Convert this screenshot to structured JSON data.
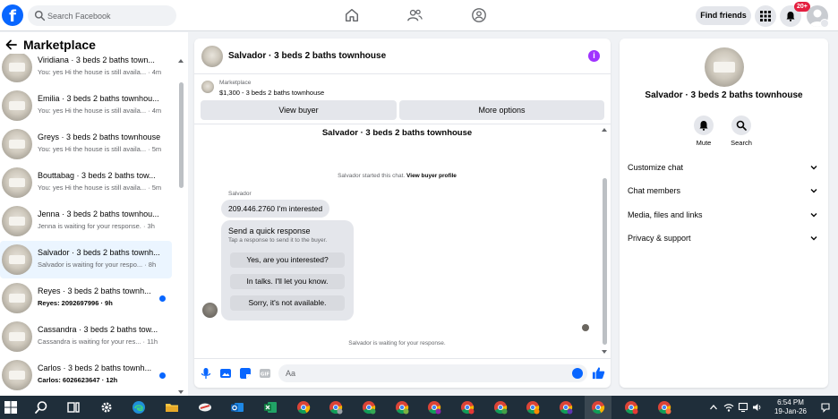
{
  "topbar": {
    "search_placeholder": "Search Facebook",
    "find_friends": "Find friends",
    "notification_count": "20+"
  },
  "left": {
    "title": "Marketplace",
    "conversations": [
      {
        "title": "Viridiana · 3 beds 2 baths town...",
        "sub": "You: yes Hi the house is still availa... · 4m",
        "unread": false,
        "active": false
      },
      {
        "title": "Emilia · 3 beds 2 baths townhou...",
        "sub": "You: yes Hi the house is still availa... · 4m",
        "unread": false,
        "active": false
      },
      {
        "title": "Greys · 3 beds 2 baths townhouse",
        "sub": "You: yes Hi the house is still availa... · 5m",
        "unread": false,
        "active": false
      },
      {
        "title": "Bouttabag · 3 beds 2 baths tow...",
        "sub": "You: yes Hi the house is still availa... · 5m",
        "unread": false,
        "active": false
      },
      {
        "title": "Jenna · 3 beds 2 baths townhou...",
        "sub": "Jenna is waiting for your response. · 3h",
        "unread": false,
        "active": false
      },
      {
        "title": "Salvador · 3 beds 2 baths townh...",
        "sub": "Salvador is waiting for your respo... · 8h",
        "unread": false,
        "active": true
      },
      {
        "title": "Reyes · 3 beds 2 baths townh...",
        "sub": "Reyes: 2092697996 · 9h",
        "unread": true,
        "active": false
      },
      {
        "title": "Cassandra · 3 beds 2 baths tow...",
        "sub": "Cassandra is waiting for your res... · 11h",
        "unread": false,
        "active": false
      },
      {
        "title": "Carlos · 3 beds 2 baths townh...",
        "sub": "Carlos: 6026623647 · 12h",
        "unread": true,
        "active": false
      }
    ]
  },
  "chat": {
    "header_title": "Salvador · 3 beds 2 baths townhouse",
    "marketplace_label": "Marketplace",
    "listing_price": "$1,300 - 3 beds 2 baths townhouse",
    "view_buyer": "View buyer",
    "more_options": "More options",
    "thread_title": "Salvador · 3 beds 2 baths townhouse",
    "started_text": "Salvador started this chat.",
    "view_buyer_profile": "View buyer profile",
    "sender_name": "Salvador",
    "message_text": "209.446.2760 I'm interested",
    "quick_title": "Send a quick response",
    "quick_sub": "Tap a response to send it to the buyer.",
    "quick_options": [
      "Yes, are you interested?",
      "In talks. I'll let you know.",
      "Sorry, it's not available."
    ],
    "waiting_text": "Salvador is waiting for your response.",
    "input_placeholder": "Aa"
  },
  "right": {
    "title": "Salvador · 3 beds 2 baths townhouse",
    "mute_label": "Mute",
    "search_label": "Search",
    "sections": [
      "Customize chat",
      "Chat members",
      "Media, files and links",
      "Privacy & support"
    ]
  },
  "taskbar": {
    "time": "6:54 PM",
    "date": "19-Jan-26"
  },
  "colors": {
    "brand": "#0866ff",
    "info": "#a033ff",
    "badge": "#e41e3f",
    "taskbar": "#1f2e3a"
  }
}
